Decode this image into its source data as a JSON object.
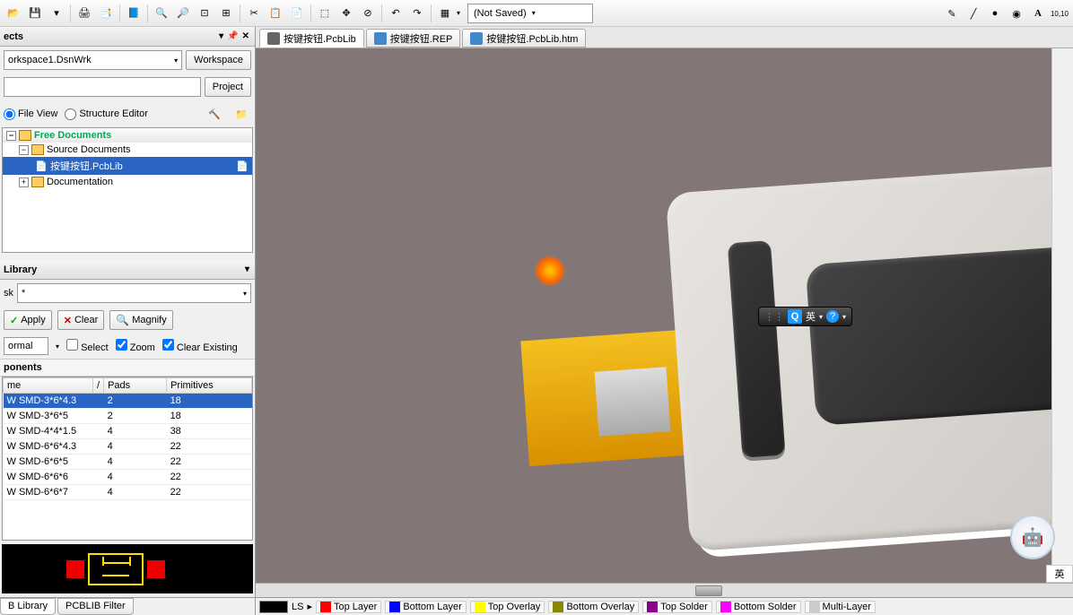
{
  "toolbar": {
    "not_saved": "(Not Saved)"
  },
  "projects_panel": {
    "title": "ects",
    "workspace_value": "orkspace1.DsnWrk",
    "workspace_btn": "Workspace",
    "project_btn": "Project",
    "file_view": "File View",
    "structure_editor": "Structure Editor",
    "tree": {
      "free_docs": "Free Documents",
      "source_docs": "Source Documents",
      "selected_file": "按键按钮.PcbLib",
      "documentation": "Documentation"
    }
  },
  "pcb_lib_panel": {
    "title": "Library",
    "mask_label": "sk",
    "mask_value": "*",
    "apply_btn": "Apply",
    "clear_btn": "Clear",
    "magnify_btn": "Magnify",
    "mode_value": "ormal",
    "select_chk": "Select",
    "zoom_chk": "Zoom",
    "clear_existing_chk": "Clear Existing",
    "components_label": "ponents",
    "cols": {
      "name": "me",
      "pads": "Pads",
      "primitives": "Primitives"
    },
    "rows": [
      {
        "name": "W SMD-3*6*4.3",
        "pads": "2",
        "primitives": "18",
        "sel": true
      },
      {
        "name": "W SMD-3*6*5",
        "pads": "2",
        "primitives": "18"
      },
      {
        "name": "W SMD-4*4*1.5",
        "pads": "4",
        "primitives": "38"
      },
      {
        "name": "W SMD-6*6*4.3",
        "pads": "4",
        "primitives": "22"
      },
      {
        "name": "W SMD-6*6*5",
        "pads": "4",
        "primitives": "22"
      },
      {
        "name": "W SMD-6*6*6",
        "pads": "4",
        "primitives": "22"
      },
      {
        "name": "W SMD-6*6*7",
        "pads": "4",
        "primitives": "22"
      }
    ]
  },
  "bottom_tabs": {
    "lib": "B Library",
    "filter": "PCBLIB Filter"
  },
  "doc_tabs": {
    "t1": "按键按钮.PcbLib",
    "t2": "按键按钮.REP",
    "t3": "按键按钮.PcbLib.htm"
  },
  "ime": {
    "q": "Q",
    "lang": "英",
    "help": "?"
  },
  "layers": {
    "ls": "LS",
    "top": "Top Layer",
    "bottom": "Bottom Layer",
    "top_overlay": "Top Overlay",
    "bottom_overlay": "Bottom Overlay",
    "top_solder": "Top Solder",
    "bottom_solder": "Bottom Solder",
    "multi": "Multi-Layer"
  },
  "status_ime": "英"
}
